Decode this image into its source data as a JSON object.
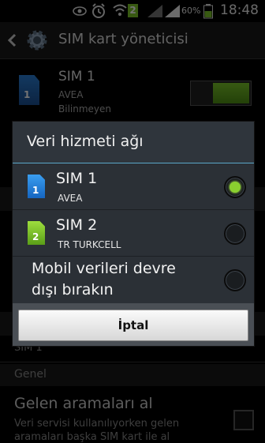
{
  "status_bar": {
    "battery_percent": "60%",
    "time": "18:48",
    "icons": [
      "eye-icon",
      "alarm-icon",
      "wifi-icon",
      "sim-2-indicator-icon",
      "signal-icon",
      "battery-icon"
    ]
  },
  "action_bar": {
    "title": "SIM kart yöneticisi",
    "back_icon": "back-icon",
    "settings_icon": "gear-icon"
  },
  "background": {
    "sim1_card": {
      "name": "SIM 1",
      "operator": "AVEA",
      "status": "Bilinmeyen",
      "badge": "1",
      "toggle_on": true
    },
    "selected_sim_text": "SIM 1",
    "section_general": "Genel",
    "incoming_calls": {
      "title": "Gelen aramaları al",
      "description_line1": "Veri servisi kullanılıyorken gelen",
      "description_line2": "aramaları başka SIM kart ile al"
    }
  },
  "dialog": {
    "title": "Veri hizmeti ağı",
    "options": [
      {
        "name": "SIM 1",
        "operator": "AVEA",
        "badge": "1",
        "selected": true
      },
      {
        "name": "SIM 2",
        "operator": "TR TURKCELL",
        "badge": "2",
        "selected": false
      },
      {
        "name_line1": "Mobil verileri devre",
        "name_line2": "dışı bırakın",
        "selected": false
      }
    ],
    "cancel_label": "İptal"
  },
  "colors": {
    "radio_selected": "#8ad02f",
    "sim1_blue": "#1e88e5",
    "sim2_green": "#7cc628",
    "dialog_divider": "#5aa7c8"
  }
}
